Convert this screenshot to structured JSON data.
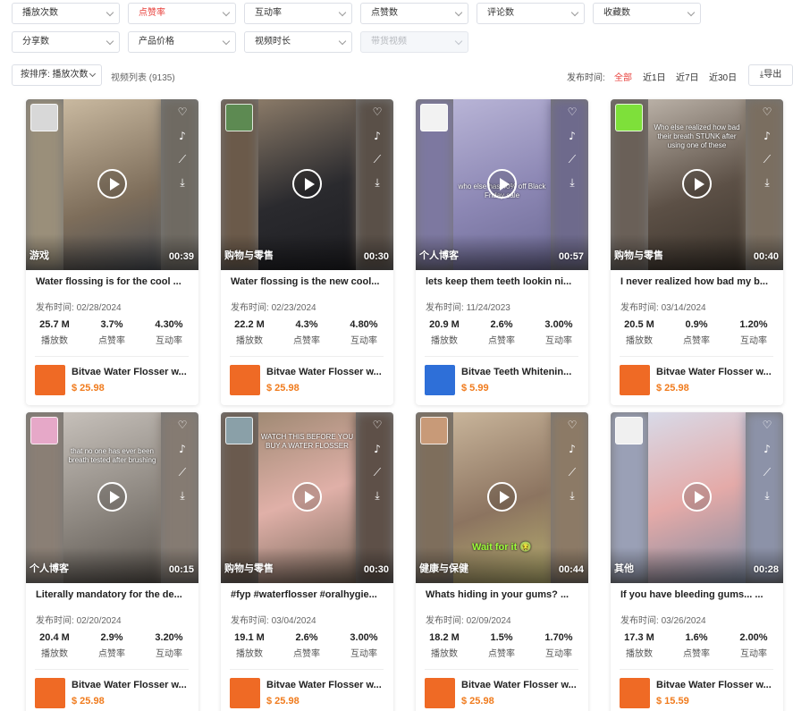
{
  "filters": {
    "row1": [
      "播放次数",
      "点赞率",
      "互动率",
      "点赞数",
      "评论数",
      "收藏数"
    ],
    "row2": [
      "分享数",
      "产品价格",
      "视频时长",
      "带货视频"
    ]
  },
  "sortbar": {
    "sort_label": "按排序: 播放次数",
    "list_count": "视频列表 (9135)",
    "pub_time_label": "发布时间:",
    "time_options": [
      "全部",
      "近1日",
      "近7日",
      "近30日"
    ],
    "export_label": "导出"
  },
  "stat_labels": [
    "播放数",
    "点赞率",
    "互动率"
  ],
  "date_prefix": "发布时间:",
  "cards": [
    {
      "category": "游戏",
      "duration": "00:39",
      "title": "Water flossing is for the cool ...",
      "date": "02/28/2024",
      "plays": "25.7 M",
      "like_rate": "3.7%",
      "engagement": "4.30%",
      "product": "Bitvae Water Flosser w...",
      "price": "$ 25.98",
      "overlay": ""
    },
    {
      "category": "购物与零售",
      "duration": "00:30",
      "title": "Water flossing is the new cool...",
      "date": "02/23/2024",
      "plays": "22.2 M",
      "like_rate": "4.3%",
      "engagement": "4.80%",
      "product": "Bitvae Water Flosser w...",
      "price": "$ 25.98",
      "overlay": ""
    },
    {
      "category": "个人博客",
      "duration": "00:57",
      "title": "lets keep them teeth lookin ni...",
      "date": "11/24/2023",
      "plays": "20.9 M",
      "like_rate": "2.6%",
      "engagement": "3.00%",
      "product": "Bitvae Teeth Whitenin...",
      "price": "$ 5.99",
      "overlay": "who else has 40% off Black Friday sale"
    },
    {
      "category": "购物与零售",
      "duration": "00:40",
      "title": "I never realized how bad my b...",
      "date": "03/14/2024",
      "plays": "20.5 M",
      "like_rate": "0.9%",
      "engagement": "1.20%",
      "product": "Bitvae Water Flosser w...",
      "price": "$ 25.98",
      "overlay": "Who else realized how bad their breath STUNK after using one of these"
    },
    {
      "category": "个人博客",
      "duration": "00:15",
      "title": "Literally mandatory for the de...",
      "date": "02/20/2024",
      "plays": "20.4 M",
      "like_rate": "2.9%",
      "engagement": "3.20%",
      "product": "Bitvae Water Flosser w...",
      "price": "$ 25.98",
      "overlay": "that no one has ever been breath tested after brushing"
    },
    {
      "category": "购物与零售",
      "duration": "00:30",
      "title": "#fyp #waterflosser #oralhygie...",
      "date": "03/04/2024",
      "plays": "19.1 M",
      "like_rate": "2.6%",
      "engagement": "3.00%",
      "product": "Bitvae Water Flosser w...",
      "price": "$ 25.98",
      "overlay": "WATCH THIS BEFORE YOU BUY A WATER FLOSSER"
    },
    {
      "category": "健康与保健",
      "duration": "00:44",
      "title": "Whats hiding in your gums? ...",
      "date": "02/09/2024",
      "plays": "18.2 M",
      "like_rate": "1.5%",
      "engagement": "1.70%",
      "product": "Bitvae Water Flosser w...",
      "price": "$ 25.98",
      "overlay": "Wait for it 🤢"
    },
    {
      "category": "其他",
      "duration": "00:28",
      "title": "If you have bleeding gums... ...",
      "date": "03/26/2024",
      "plays": "17.3 M",
      "like_rate": "1.6%",
      "engagement": "2.00%",
      "product": "Bitvae Water Flosser w...",
      "price": "$ 15.59",
      "overlay": ""
    }
  ],
  "colors": {
    "accent_red": "#e8413c",
    "price_orange": "#f07b1d",
    "product_orange": "#ef6a25"
  },
  "icons": [
    "heart-icon",
    "tiktok-icon",
    "trend-icon",
    "download-icon",
    "play-icon"
  ]
}
